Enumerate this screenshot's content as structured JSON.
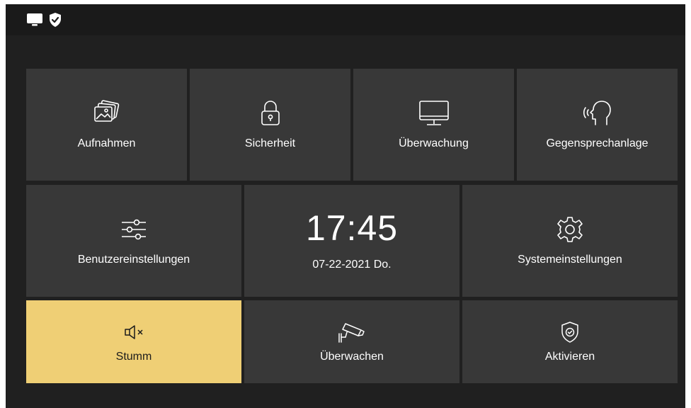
{
  "status_bar": {
    "icons": [
      "monitor-icon",
      "shield-check-icon"
    ]
  },
  "tiles": {
    "aufnahmen": {
      "label": "Aufnahmen",
      "icon": "photos-icon"
    },
    "sicherheit": {
      "label": "Sicherheit",
      "icon": "lock-icon"
    },
    "ueberwachung": {
      "label": "Überwachung",
      "icon": "monitor-icon"
    },
    "gegensprechanlage": {
      "label": "Gegensprechanlage",
      "icon": "speaking-head-icon"
    },
    "benutzereinstellungen": {
      "label": "Benutzereinstellungen",
      "icon": "sliders-icon"
    },
    "clock": {
      "time": "17:45",
      "date": "07-22-2021 Do."
    },
    "systemeinstellungen": {
      "label": "Systemeinstellungen",
      "icon": "gear-icon"
    },
    "stumm": {
      "label": "Stumm",
      "icon": "speaker-mute-icon",
      "active": true
    },
    "ueberwachen": {
      "label": "Überwachen",
      "icon": "security-camera-icon"
    },
    "aktivieren": {
      "label": "Aktivieren",
      "icon": "shield-check-icon"
    }
  },
  "colors": {
    "screen_bg": "#202020",
    "status_bg": "#1a1a1a",
    "tile_bg": "#383838",
    "active_tile_bg": "#efcf75",
    "text": "#ffffff",
    "active_text": "#1c1c1c"
  }
}
